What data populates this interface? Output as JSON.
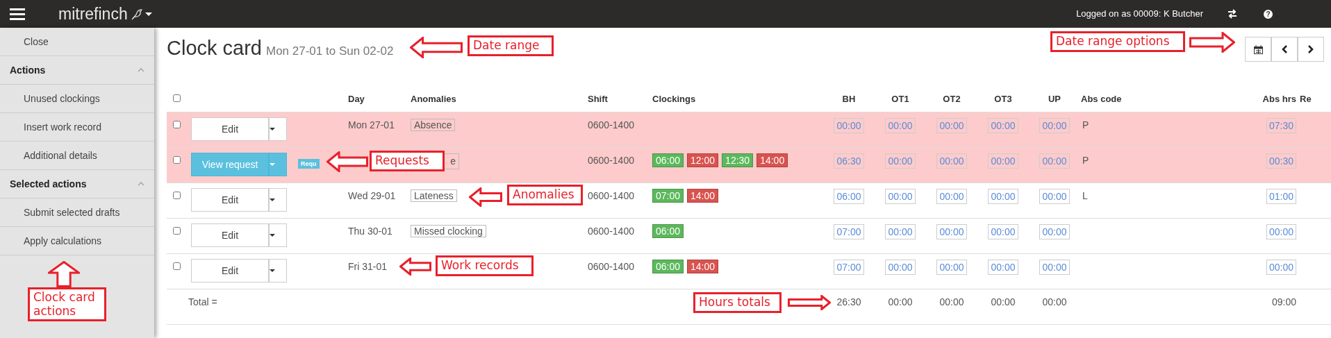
{
  "navbar": {
    "brand": "mitrefinch",
    "user": "Logged on as 00009: K Butcher",
    "help": "?"
  },
  "sidebar": {
    "close": "Close",
    "groups": [
      {
        "title": "Actions",
        "expanded": true,
        "items": [
          "Unused clockings",
          "Insert work record",
          "Additional details"
        ]
      },
      {
        "title": "Selected actions",
        "expanded": true,
        "items": [
          "Submit selected drafts",
          "Apply calculations"
        ]
      }
    ]
  },
  "page": {
    "title": "Clock card",
    "date_range": "Mon 27-01 to Sun 02-02"
  },
  "table": {
    "columns": [
      "Day",
      "Anomalies",
      "Shift",
      "Clockings",
      "BH",
      "OT1",
      "OT2",
      "OT3",
      "UP",
      "Abs code",
      "Abs hrs",
      "Re"
    ],
    "select_all_checked": false,
    "rows": [
      {
        "checked": false,
        "highlighted": true,
        "action": {
          "label": "Edit",
          "kind": "edit"
        },
        "day": "Mon 27-01",
        "anomaly": "Absence",
        "shift": "0600-1400",
        "clockings": [],
        "hours": [
          "00:00",
          "00:00",
          "00:00",
          "00:00",
          "00:00"
        ],
        "abs_code": "P",
        "abs_hrs": "07:30"
      },
      {
        "checked": false,
        "highlighted": true,
        "action": {
          "label": "View request",
          "kind": "request"
        },
        "badge": "Requ",
        "anomaly": "e",
        "shift": "0600-1400",
        "clockings": [
          {
            "time": "06:00",
            "color": "#5cb85c"
          },
          {
            "time": "12:00",
            "color": "#d9534f"
          },
          {
            "time": "12:30",
            "color": "#5cb85c"
          },
          {
            "time": "14:00",
            "color": "#d9534f"
          }
        ],
        "hours": [
          "06:30",
          "00:00",
          "00:00",
          "00:00",
          "00:00"
        ],
        "abs_code": "P",
        "abs_hrs": "00:30"
      },
      {
        "checked": false,
        "highlighted": false,
        "action": {
          "label": "Edit",
          "kind": "edit"
        },
        "day": "Wed 29-01",
        "anomaly": "Lateness",
        "shift": "0600-1400",
        "clockings": [
          {
            "time": "07:00",
            "color": "#5cb85c"
          },
          {
            "time": "14:00",
            "color": "#d9534f"
          }
        ],
        "hours": [
          "06:00",
          "00:00",
          "00:00",
          "00:00",
          "00:00"
        ],
        "abs_code": "L",
        "abs_hrs": "01:00"
      },
      {
        "checked": false,
        "highlighted": false,
        "action": {
          "label": "Edit",
          "kind": "edit"
        },
        "day": "Thu 30-01",
        "anomaly": "Missed clocking",
        "shift": "0600-1400",
        "clockings": [
          {
            "time": "06:00",
            "color": "#5cb85c"
          }
        ],
        "hours": [
          "07:00",
          "00:00",
          "00:00",
          "00:00",
          "00:00"
        ],
        "abs_hrs": "00:00"
      },
      {
        "checked": false,
        "highlighted": false,
        "action": {
          "label": "Edit",
          "kind": "edit"
        },
        "day": "Fri 31-01",
        "shift": "0600-1400",
        "clockings": [
          {
            "time": "06:00",
            "color": "#5cb85c"
          },
          {
            "time": "14:00",
            "color": "#d9534f"
          }
        ],
        "hours": [
          "07:00",
          "00:00",
          "00:00",
          "00:00",
          "00:00"
        ],
        "abs_hrs": "00:00"
      }
    ],
    "totals": {
      "label": "Total =",
      "hours": [
        "26:30",
        "00:00",
        "00:00",
        "00:00",
        "00:00"
      ],
      "abs_hrs": "09:00"
    }
  },
  "annotations": [
    {
      "label": "Date range",
      "kind": "left"
    },
    {
      "label": "Date range options",
      "kind": "right"
    },
    {
      "label": "Requests",
      "kind": "left"
    },
    {
      "label": "Anomalies",
      "kind": "left"
    },
    {
      "label": "Work records",
      "kind": "left"
    },
    {
      "label": "Hours totals",
      "kind": "right"
    },
    {
      "label": "Clock card actions",
      "kind": "up"
    }
  ]
}
